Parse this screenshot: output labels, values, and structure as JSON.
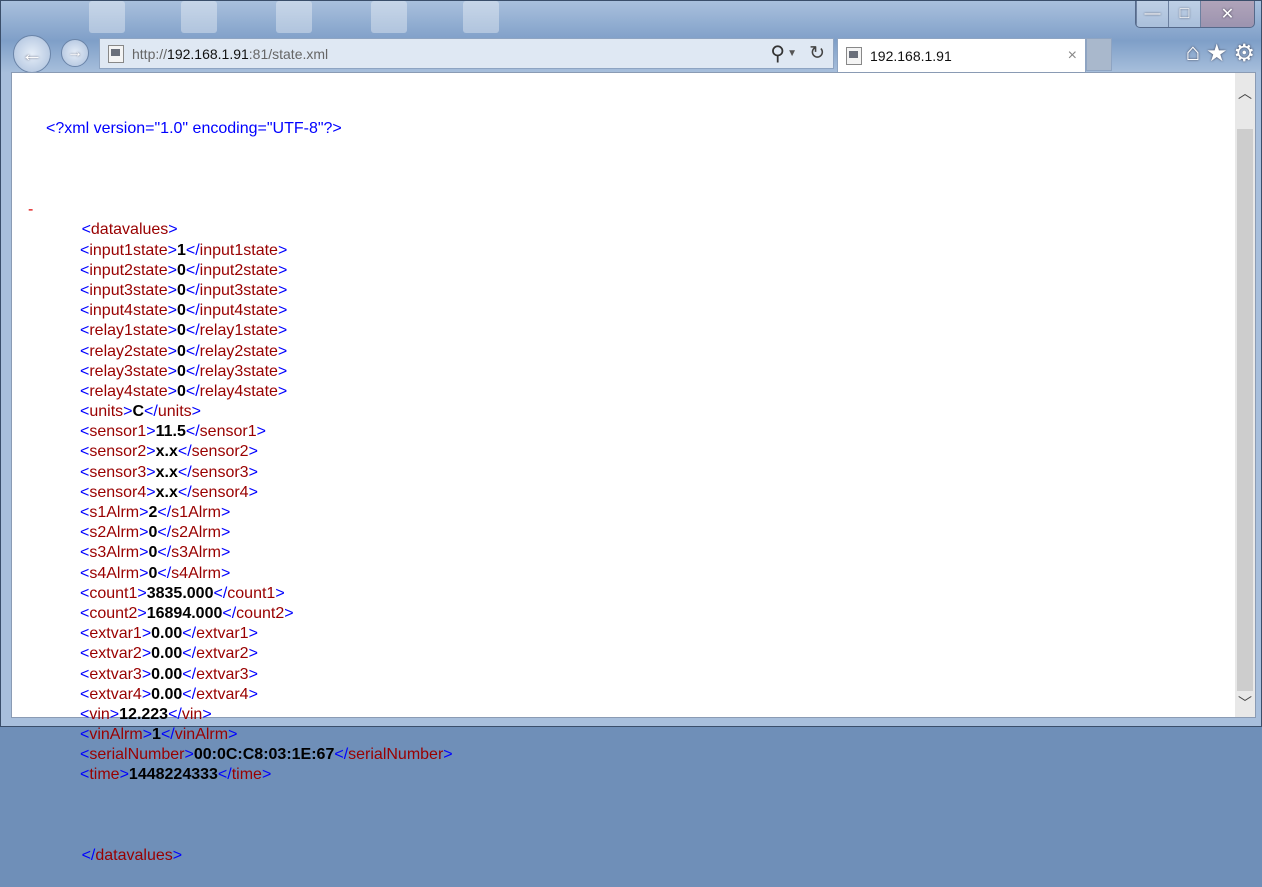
{
  "browser": {
    "url_prefix": "http://",
    "url_host": "192.168.1.91",
    "url_rest": ":81/state.xml",
    "tab_title": "192.168.1.91",
    "tab_close": "×",
    "window_buttons": [
      "—",
      "□",
      "✕"
    ]
  },
  "xml": {
    "declaration": "<?xml version=\"1.0\" encoding=\"UTF-8\"?>",
    "collapse_marker": "-",
    "root": "datavalues",
    "elements": [
      {
        "tag": "input1state",
        "value": "1"
      },
      {
        "tag": "input2state",
        "value": "0"
      },
      {
        "tag": "input3state",
        "value": "0"
      },
      {
        "tag": "input4state",
        "value": "0"
      },
      {
        "tag": "relay1state",
        "value": "0"
      },
      {
        "tag": "relay2state",
        "value": "0"
      },
      {
        "tag": "relay3state",
        "value": "0"
      },
      {
        "tag": "relay4state",
        "value": "0"
      },
      {
        "tag": "units",
        "value": "C"
      },
      {
        "tag": "sensor1",
        "value": "11.5"
      },
      {
        "tag": "sensor2",
        "value": "x.x"
      },
      {
        "tag": "sensor3",
        "value": "x.x"
      },
      {
        "tag": "sensor4",
        "value": "x.x"
      },
      {
        "tag": "s1Alrm",
        "value": "2"
      },
      {
        "tag": "s2Alrm",
        "value": "0"
      },
      {
        "tag": "s3Alrm",
        "value": "0"
      },
      {
        "tag": "s4Alrm",
        "value": "0"
      },
      {
        "tag": "count1",
        "value": "3835.000"
      },
      {
        "tag": "count2",
        "value": "16894.000"
      },
      {
        "tag": "extvar1",
        "value": "0.00"
      },
      {
        "tag": "extvar2",
        "value": "0.00"
      },
      {
        "tag": "extvar3",
        "value": "0.00"
      },
      {
        "tag": "extvar4",
        "value": "0.00"
      },
      {
        "tag": "vin",
        "value": "12.223"
      },
      {
        "tag": "vinAlrm",
        "value": "1"
      },
      {
        "tag": "serialNumber",
        "value": "00:0C:C8:03:1E:67"
      },
      {
        "tag": "time",
        "value": "1448224333"
      }
    ]
  }
}
